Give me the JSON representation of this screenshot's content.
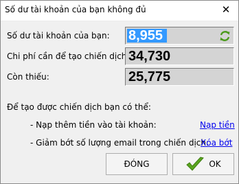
{
  "window": {
    "title": "Số dư tài khoản của bạn không đủ",
    "close_glyph": "✕"
  },
  "fields": {
    "balance_label": "Số dư tài khoản của bạn:",
    "balance_value": "8,955",
    "cost_label": "Chi phí cần để tạo chiến dịch:",
    "cost_value": "34,730",
    "shortfall_label": "Còn thiếu:",
    "shortfall_value": "25,775"
  },
  "options": {
    "heading": "Để tạo được chiến dịch bạn có thể:",
    "topup_text": "- Nạp thêm tiền vào tài khoản:",
    "topup_link": "Nạp tiền",
    "reduce_text": "- Giảm bớt số lượng email trong chiến dịch:",
    "reduce_link": "Xóa bớt"
  },
  "buttons": {
    "close_label": "ĐÓNG",
    "ok_label": "OK"
  },
  "icons": {
    "refresh": "refresh-icon",
    "check": "check-icon"
  },
  "colors": {
    "selection": "#3399ff",
    "link": "#0000ee",
    "check_green": "#5aa51f"
  }
}
